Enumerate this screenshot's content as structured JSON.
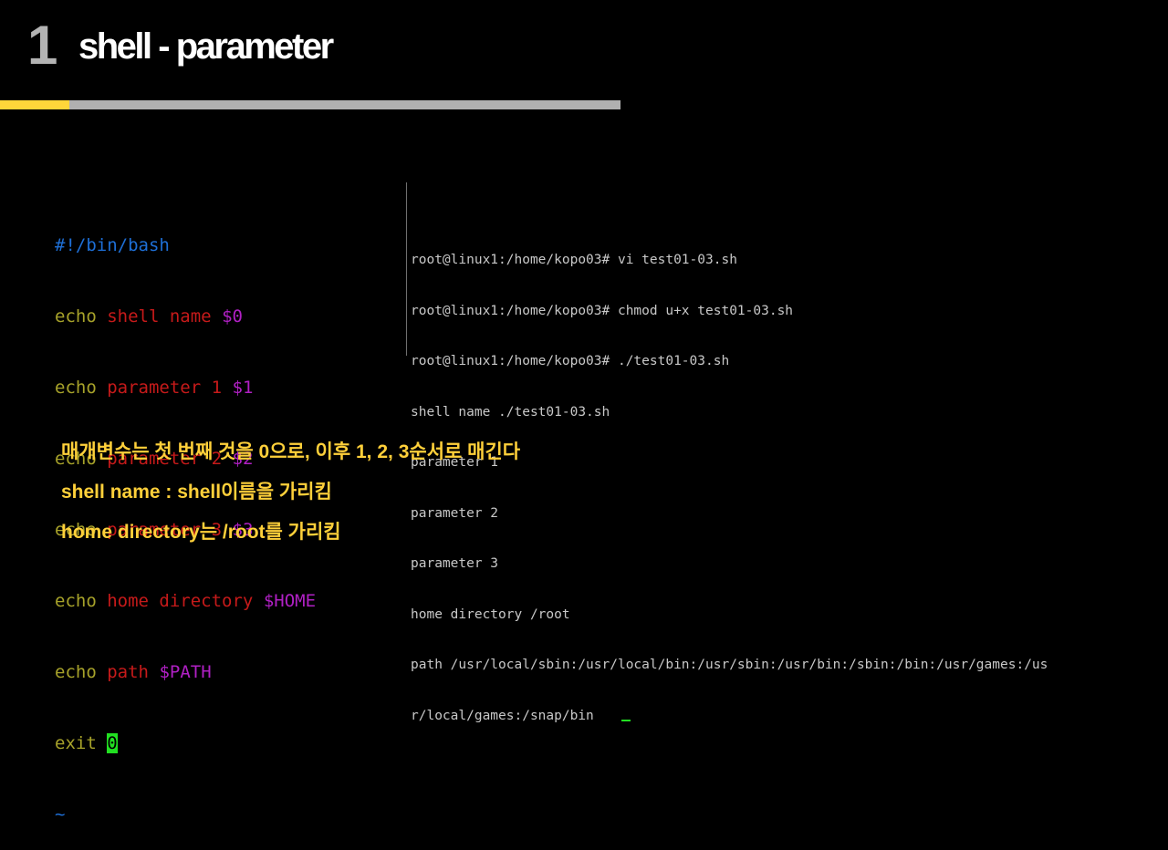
{
  "slide": {
    "number": "1",
    "title": "shell - parameter",
    "accent_color": "#ffd63a",
    "bar_color": "#b0b0b0"
  },
  "vi_editor": {
    "shebang": "#!/bin/bash",
    "lines": [
      {
        "cmd": "echo",
        "text": "shell name",
        "var": "$0"
      },
      {
        "cmd": "echo",
        "text": "parameter 1",
        "var": "$1"
      },
      {
        "cmd": "echo",
        "text": "parameter 2",
        "var": "$2"
      },
      {
        "cmd": "echo",
        "text": "parameter 3",
        "var": "$3"
      },
      {
        "cmd": "echo",
        "text": "home directory",
        "var": "$HOME"
      },
      {
        "cmd": "echo",
        "text": "path",
        "var": "$PATH"
      }
    ],
    "exit_cmd": "exit",
    "exit_code": "0",
    "tilde": "~"
  },
  "terminal": {
    "lines": [
      "root@linux1:/home/kopo03# vi test01-03.sh",
      "root@linux1:/home/kopo03# chmod u+x test01-03.sh",
      "root@linux1:/home/kopo03# ./test01-03.sh",
      "shell name ./test01-03.sh",
      "parameter 1",
      "parameter 2",
      "parameter 3",
      "home directory /root",
      "path /usr/local/sbin:/usr/local/bin:/usr/sbin:/usr/bin:/sbin:/bin:/usr/games:/us",
      "r/local/games:/snap/bin"
    ]
  },
  "notes": [
    "매개변수는 첫 번째 것을 0으로, 이후 1, 2, 3순서로 매긴다",
    "shell name : shell이름을 가리킴",
    "home directory는 /root를 가리킴"
  ]
}
